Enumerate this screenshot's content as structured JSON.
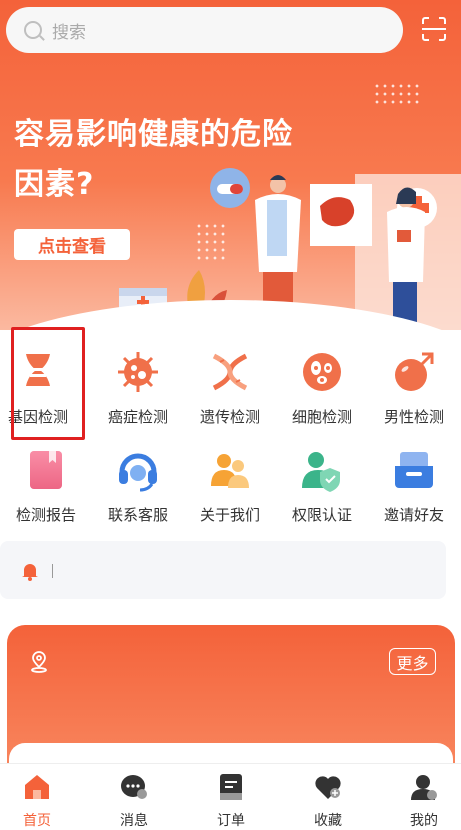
{
  "search": {
    "placeholder": "搜索"
  },
  "banner": {
    "title_line1": "容易影响健康的危险",
    "title_line2": "因素?",
    "cta_label": "点击查看"
  },
  "services": [
    {
      "label": "基因检测",
      "icon": "gene-test-icon",
      "selected": true
    },
    {
      "label": "癌症检测",
      "icon": "virus-icon"
    },
    {
      "label": "遗传检测",
      "icon": "dna-icon"
    },
    {
      "label": "细胞检测",
      "icon": "cell-icon"
    },
    {
      "label": "男性检测",
      "icon": "male-icon"
    },
    {
      "label": "检测报告",
      "icon": "report-icon"
    },
    {
      "label": "联系客服",
      "icon": "headset-icon"
    },
    {
      "label": "关于我们",
      "icon": "people-icon"
    },
    {
      "label": "权限认证",
      "icon": "user-shield-icon"
    },
    {
      "label": "邀请好友",
      "icon": "inbox-icon"
    }
  ],
  "card": {
    "more_label": "更多"
  },
  "tabs": [
    {
      "label": "首页",
      "icon": "home-icon",
      "active": true
    },
    {
      "label": "消息",
      "icon": "message-icon"
    },
    {
      "label": "订单",
      "icon": "order-icon"
    },
    {
      "label": "收藏",
      "icon": "favorite-icon"
    },
    {
      "label": "我的",
      "icon": "profile-icon"
    }
  ],
  "colors": {
    "accent": "#f4623a",
    "selection": "#e02020"
  }
}
